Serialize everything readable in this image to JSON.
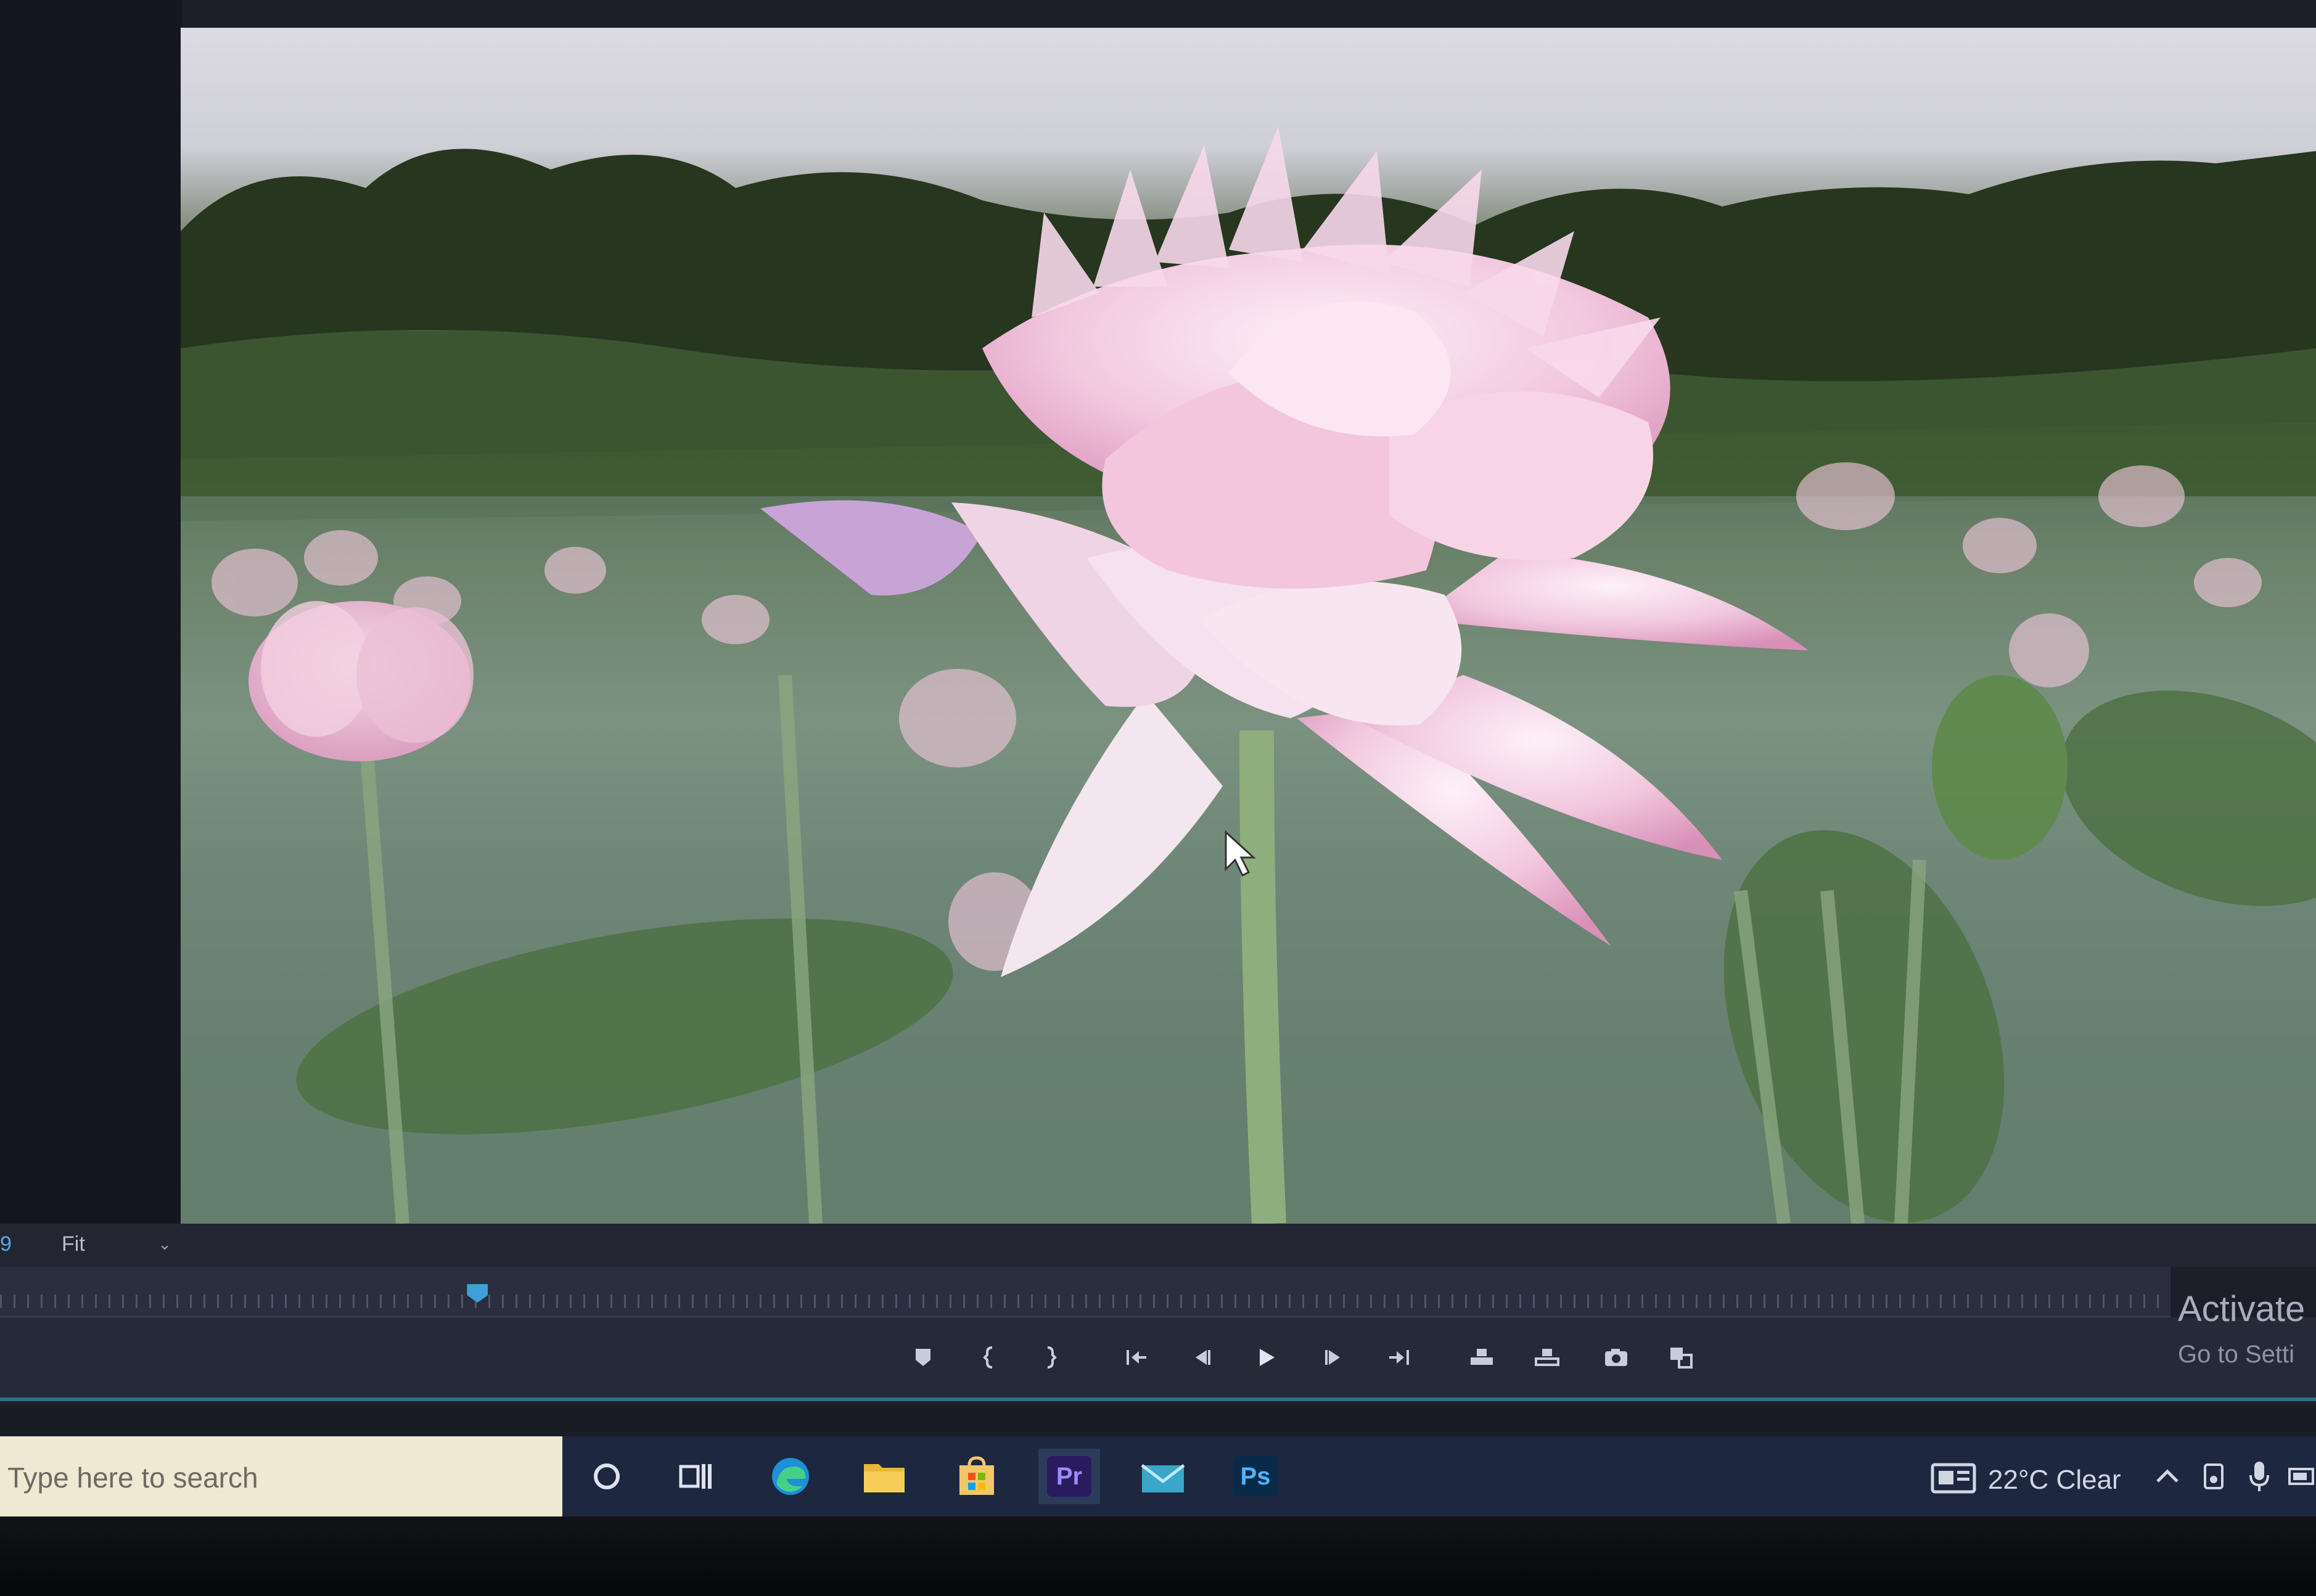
{
  "monitor": {
    "zoom_prefix": "9",
    "zoom_value": "Fit",
    "playhead_progress": 0.22
  },
  "transport_controls": [
    "add-marker",
    "mark-in",
    "mark-out",
    "go-to-in",
    "step-back",
    "play",
    "step-forward",
    "go-to-out",
    "insert",
    "overwrite",
    "export-frame",
    "button-editor"
  ],
  "watermark": {
    "title": "Activate",
    "subtitle": "Go to Setti"
  },
  "taskbar": {
    "search_placeholder": "Type here to search",
    "pinned_apps": [
      "cortana",
      "task-view",
      "edge",
      "file-explorer",
      "microsoft-store",
      "premiere-pro",
      "mail",
      "photoshop"
    ],
    "premiere_label": "Pr",
    "photoshop_label": "Ps",
    "weather": {
      "temperature": "22°C",
      "condition": "Clear"
    }
  },
  "colors": {
    "accent": "#3fa0d8",
    "panel": "#262938",
    "taskbar": "#1d2740",
    "search": "#efe8d2",
    "premiere_bg": "#2a1b5e",
    "premiere_fg": "#9a8cff",
    "photoshop_bg": "#0a2a4a",
    "photoshop_fg": "#4fb4ff"
  }
}
